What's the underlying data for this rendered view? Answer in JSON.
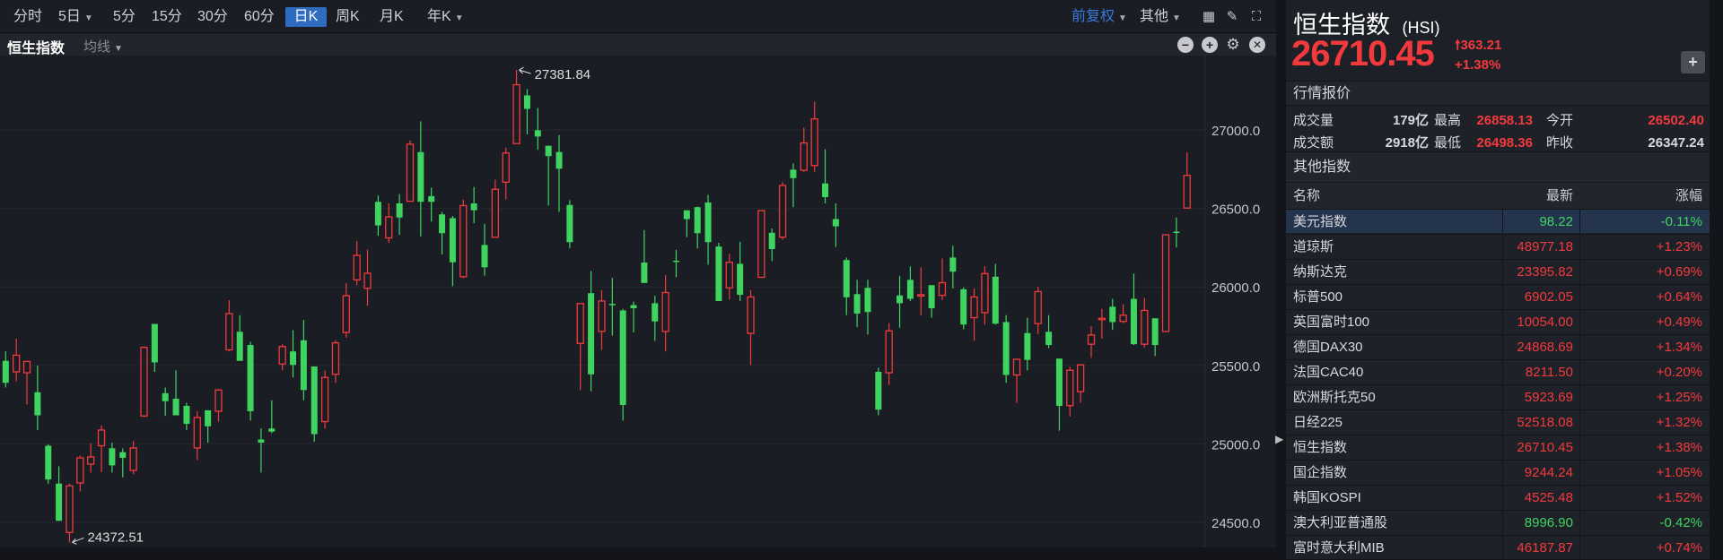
{
  "toolbar": {
    "periods": [
      "分时",
      "5日",
      "5分",
      "15分",
      "30分",
      "60分",
      "日K",
      "周K",
      "月K",
      "年K"
    ],
    "active_period": "日K",
    "adjust": "前复权",
    "other": "其他"
  },
  "subbar": {
    "indicator_name": "恒生指数",
    "ma_label": "均线"
  },
  "quote": {
    "name": "恒生指数",
    "code": "(HSI)",
    "price": "26710.45",
    "change": "363.21",
    "change_pct": "+1.38%",
    "section_title": "行情报价",
    "stats": [
      {
        "label": "成交量",
        "value": "179亿",
        "label2": "最高",
        "value2": "26858.13",
        "label3": "今开",
        "value3": "26502.40"
      },
      {
        "label": "成交额",
        "value": "2918亿",
        "label2": "最低",
        "value2": "26498.36",
        "label3": "昨收",
        "value3": "26347.24"
      }
    ]
  },
  "other_indices": {
    "title": "其他指数",
    "headers": [
      "名称",
      "最新",
      "涨幅"
    ],
    "rows": [
      {
        "name": "美元指数",
        "last": "98.22",
        "pct": "-0.11%",
        "dir": "down"
      },
      {
        "name": "道琼斯",
        "last": "48977.18",
        "pct": "+1.23%",
        "dir": "up"
      },
      {
        "name": "纳斯达克",
        "last": "23395.82",
        "pct": "+0.69%",
        "dir": "up"
      },
      {
        "name": "标普500",
        "last": "6902.05",
        "pct": "+0.64%",
        "dir": "up"
      },
      {
        "name": "英国富时100",
        "last": "10054.00",
        "pct": "+0.49%",
        "dir": "up"
      },
      {
        "name": "德国DAX30",
        "last": "24868.69",
        "pct": "+1.34%",
        "dir": "up"
      },
      {
        "name": "法国CAC40",
        "last": "8211.50",
        "pct": "+0.20%",
        "dir": "up"
      },
      {
        "name": "欧洲斯托克50",
        "last": "5923.69",
        "pct": "+1.25%",
        "dir": "up"
      },
      {
        "name": "日经225",
        "last": "52518.08",
        "pct": "+1.32%",
        "dir": "up"
      },
      {
        "name": "恒生指数",
        "last": "26710.45",
        "pct": "+1.38%",
        "dir": "up"
      },
      {
        "name": "国企指数",
        "last": "9244.24",
        "pct": "+1.05%",
        "dir": "up"
      },
      {
        "name": "韩国KOSPI",
        "last": "4525.48",
        "pct": "+1.52%",
        "dir": "up"
      },
      {
        "name": "澳大利亚普通股",
        "last": "8996.90",
        "pct": "-0.42%",
        "dir": "down"
      },
      {
        "name": "富时意大利MIB",
        "last": "46187.87",
        "pct": "+0.74%",
        "dir": "up"
      }
    ]
  },
  "colors": {
    "up": "#f23a3d",
    "down": "#3fd460",
    "accent": "#2f6cc0"
  },
  "chart_data": {
    "type": "candlestick",
    "title": "恒生指数 日K",
    "ylim": [
      24300,
      27450
    ],
    "yticks": [
      "27000.0",
      "26500.0",
      "26000.0",
      "25500.0",
      "25000.0",
      "24500.0"
    ],
    "annotations": {
      "high": "27381.84",
      "low": "24372.51"
    },
    "ohlc": [
      [
        25529,
        25589,
        25359,
        25389
      ],
      [
        25459,
        25670,
        25399,
        25565
      ],
      [
        25453,
        25530,
        25252,
        25525
      ],
      [
        25329,
        25499,
        25088,
        25182
      ],
      [
        24988,
        24998,
        24747,
        24773
      ],
      [
        24747,
        24857,
        24510,
        24510
      ],
      [
        24436,
        24747,
        24372.51,
        24733
      ],
      [
        24751,
        24927,
        24697,
        24911
      ],
      [
        24871,
        25004,
        24817,
        24917
      ],
      [
        24988,
        25118,
        24821,
        25088
      ],
      [
        24972,
        25008,
        24817,
        24863
      ],
      [
        24947,
        24972,
        24787,
        24911
      ],
      [
        24831,
        25018,
        24807,
        24974
      ],
      [
        25178,
        25620,
        25170,
        25615
      ],
      [
        25764,
        25764,
        25459,
        25519
      ],
      [
        25323,
        25359,
        25178,
        25272
      ],
      [
        25288,
        25469,
        25182,
        25182
      ],
      [
        25242,
        25262,
        25088,
        25128
      ],
      [
        24974,
        25208,
        24897,
        25168
      ],
      [
        25214,
        25214,
        25008,
        25112
      ],
      [
        25208,
        25349,
        25142,
        25343
      ],
      [
        25599,
        25915,
        25589,
        25830
      ],
      [
        25714,
        25820,
        25529,
        25529
      ],
      [
        25630,
        25650,
        25148,
        25208
      ],
      [
        25028,
        25098,
        24817,
        25008
      ],
      [
        25098,
        25278,
        25068,
        25078
      ],
      [
        25509,
        25635,
        25469,
        25620
      ],
      [
        25589,
        25724,
        25423,
        25503
      ],
      [
        25660,
        25790,
        25278,
        25343
      ],
      [
        25493,
        25493,
        25014,
        25062
      ],
      [
        25142,
        25469,
        25098,
        25423
      ],
      [
        25443,
        25660,
        25389,
        25644
      ],
      [
        25710,
        26025,
        25676,
        25944
      ],
      [
        26045,
        26292,
        26011,
        26201
      ],
      [
        25991,
        26237,
        25880,
        26087
      ],
      [
        26542,
        26582,
        26326,
        26392
      ],
      [
        26312,
        26532,
        26281,
        26446
      ],
      [
        26532,
        26592,
        26332,
        26442
      ],
      [
        26546,
        26933,
        26542,
        26909
      ],
      [
        26859,
        27054,
        26322,
        26542
      ],
      [
        26578,
        26632,
        26416,
        26542
      ],
      [
        26462,
        26478,
        26207,
        26342
      ],
      [
        26438,
        26452,
        26005,
        26157
      ],
      [
        26065,
        26556,
        26057,
        26518
      ],
      [
        26532,
        26636,
        26406,
        26488
      ],
      [
        26267,
        26402,
        26071,
        26125
      ],
      [
        26316,
        26683,
        26316,
        26622
      ],
      [
        26667,
        26887,
        26558,
        26853
      ],
      [
        26913,
        27381.84,
        26913,
        27288
      ],
      [
        27220,
        27260,
        26973,
        27134
      ],
      [
        26998,
        27140,
        26873,
        26958
      ],
      [
        26899,
        26899,
        26518,
        26833
      ],
      [
        26859,
        26967,
        26478,
        26753
      ],
      [
        26522,
        26552,
        26247,
        26285
      ],
      [
        25640,
        25894,
        25343,
        25894
      ],
      [
        25960,
        26101,
        25335,
        25443
      ],
      [
        25716,
        25980,
        25599,
        25910
      ],
      [
        25892,
        26057,
        25690,
        25890
      ],
      [
        25850,
        25860,
        25148,
        25248
      ],
      [
        25884,
        25906,
        25710,
        25864
      ],
      [
        26155,
        26362,
        26025,
        26025
      ],
      [
        25896,
        25944,
        25656,
        25780
      ],
      [
        25716,
        26075,
        25589,
        25964
      ],
      [
        26167,
        26236,
        26061,
        26165
      ],
      [
        26488,
        26488,
        26317,
        26432
      ],
      [
        26508,
        26512,
        26245,
        26342
      ],
      [
        26538,
        26586,
        26141,
        26285
      ],
      [
        26257,
        26281,
        25910,
        25910
      ],
      [
        25994,
        26211,
        25920,
        26157
      ],
      [
        26147,
        26287,
        25910,
        25950
      ],
      [
        25704,
        25980,
        25503,
        25936
      ],
      [
        26061,
        26486,
        26061,
        26486
      ],
      [
        26345,
        26372,
        26165,
        26241
      ],
      [
        26317,
        26667,
        26301,
        26646
      ],
      [
        26747,
        26787,
        26508,
        26693
      ],
      [
        26743,
        27014,
        26733,
        26917
      ],
      [
        26773,
        27180,
        26733,
        27070
      ],
      [
        26659,
        26877,
        26532,
        26572
      ],
      [
        26432,
        26532,
        26255,
        26386
      ],
      [
        26171,
        26187,
        25820,
        25934
      ],
      [
        25954,
        26045,
        25744,
        25830
      ],
      [
        25994,
        26045,
        25696,
        25840
      ],
      [
        25459,
        25485,
        25182,
        25218
      ],
      [
        25453,
        25770,
        25375,
        25720
      ],
      [
        25946,
        26071,
        25740,
        25896
      ],
      [
        26045,
        26131,
        25910,
        25924
      ],
      [
        25948,
        26125,
        25820,
        25950
      ],
      [
        26011,
        26011,
        25804,
        25864
      ],
      [
        25946,
        26181,
        25916,
        26027
      ],
      [
        26187,
        26262,
        25990,
        26097
      ],
      [
        25985,
        25997,
        25730,
        25760
      ],
      [
        25804,
        25990,
        25656,
        25936
      ],
      [
        25836,
        26131,
        25760,
        26085
      ],
      [
        26065,
        26147,
        25760,
        25766
      ],
      [
        25776,
        25820,
        25389,
        25439
      ],
      [
        25439,
        25539,
        25262,
        25539
      ],
      [
        25706,
        25804,
        25469,
        25535
      ],
      [
        25766,
        26000,
        25700,
        25970
      ],
      [
        25714,
        25820,
        25610,
        25630
      ],
      [
        25543,
        25543,
        25084,
        25242
      ],
      [
        25244,
        25489,
        25174,
        25469
      ],
      [
        25333,
        25509,
        25262,
        25503
      ],
      [
        25635,
        25750,
        25549,
        25694
      ],
      [
        25798,
        25860,
        25670,
        25800
      ],
      [
        25874,
        25924,
        25726,
        25776
      ],
      [
        25780,
        25890,
        25770,
        25820
      ],
      [
        25924,
        26085,
        25630,
        25635
      ],
      [
        25635,
        25930,
        25615,
        25850
      ],
      [
        25800,
        25800,
        25560,
        25630
      ],
      [
        25716,
        26332,
        25716,
        26332
      ],
      [
        26352,
        26442,
        26251,
        26350
      ],
      [
        26502.4,
        26858.13,
        26498.36,
        26710.45
      ]
    ]
  }
}
